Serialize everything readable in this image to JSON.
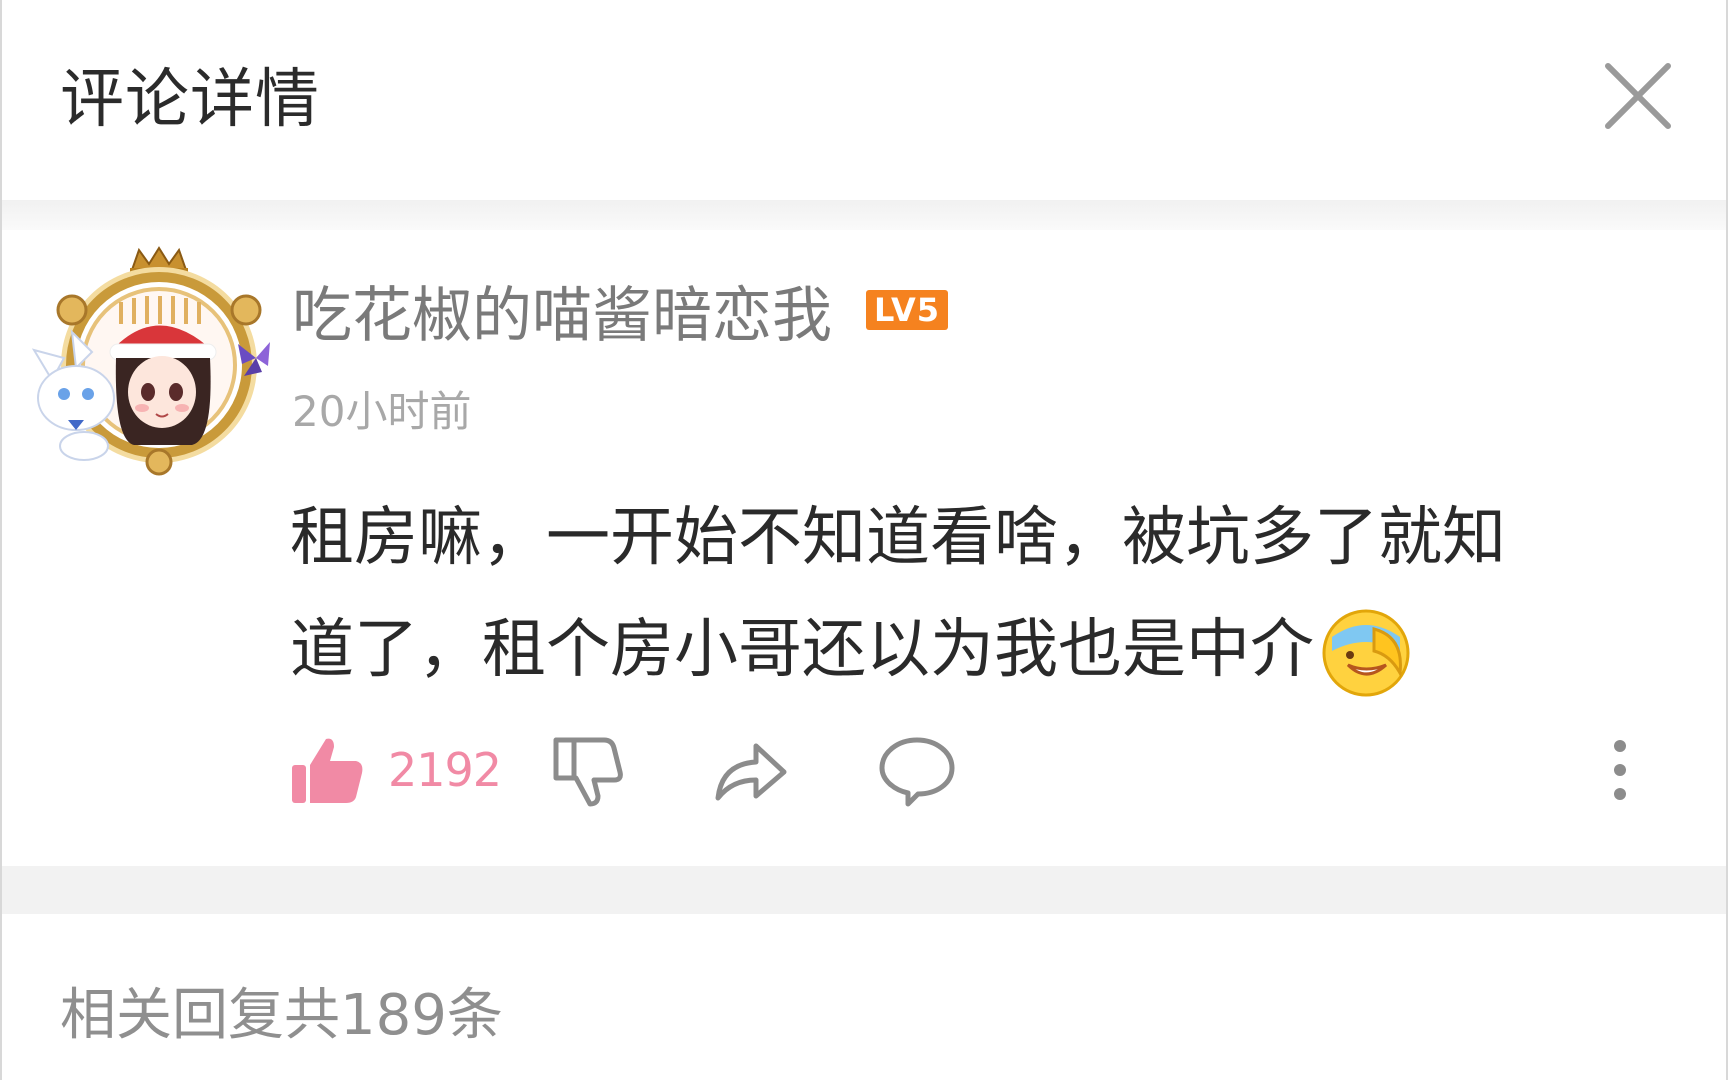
{
  "header": {
    "title": "评论详情",
    "close_icon": "close-icon"
  },
  "comment": {
    "username": "吃花椒的喵酱暗恋我",
    "level": "LV5",
    "timestamp": "20小时前",
    "text_line1": "租房嘛，一开始不知道看啥，被坑多了就知",
    "text_line2": "道了，租个房小哥还以为我也是中介",
    "emoji": "facepalm-laugh-emoji",
    "likes": "2192",
    "liked": true,
    "colors": {
      "like": "#f18aa5",
      "level_badge": "#f5821f",
      "icon_gray": "#8c8c8c"
    }
  },
  "replies": {
    "summary": "相关回复共189条"
  }
}
